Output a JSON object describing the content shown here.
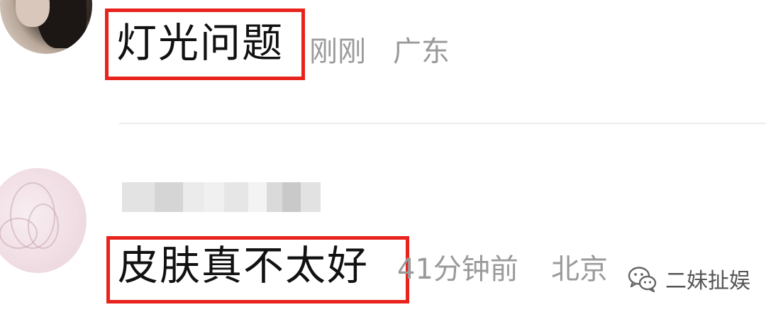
{
  "comments": [
    {
      "text": "灯光问题",
      "time": "刚刚",
      "location": "广东",
      "highlight_color": "#e8231c"
    },
    {
      "username_blurred": true,
      "text": "皮肤真不太好",
      "time": "41分钟前",
      "location": "北京",
      "highlight_color": "#e8231c"
    }
  ],
  "watermark": {
    "icon": "wechat-icon",
    "text": "二妹扯娱"
  },
  "colors": {
    "comment_text": "#111111",
    "meta_text": "#9a9a9a",
    "divider": "#ececec"
  }
}
